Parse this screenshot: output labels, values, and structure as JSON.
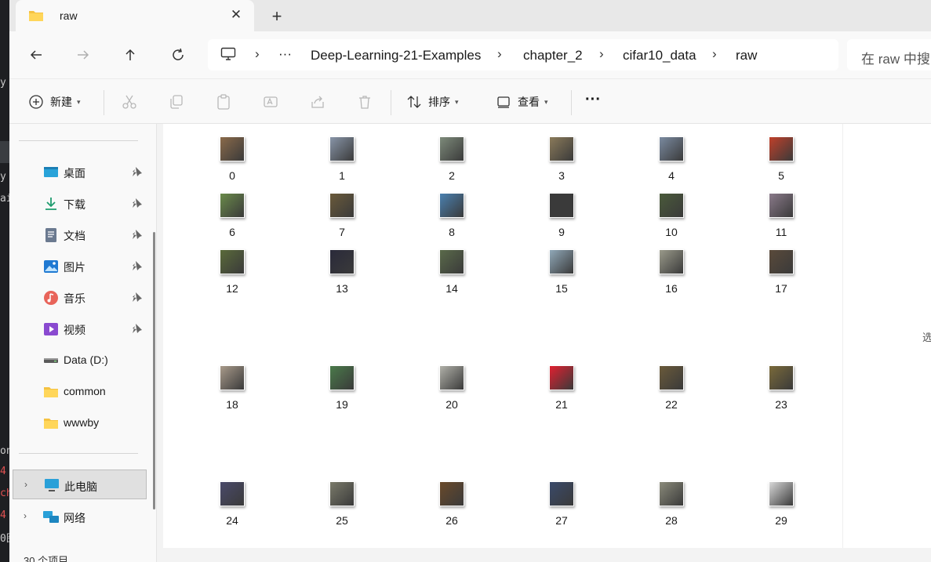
{
  "window": {
    "tab_title": "raw"
  },
  "nav": {
    "ellipsis": "···",
    "breadcrumb": [
      "Deep-Learning-21-Examples",
      "chapter_2",
      "cifar10_data",
      "raw"
    ],
    "search_placeholder": "在 raw 中搜"
  },
  "toolbar": {
    "new_label": "新建",
    "sort_label": "排序",
    "view_label": "查看",
    "more_label": "···"
  },
  "sidebar": {
    "quick": [
      {
        "label": "桌面",
        "icon": "desktop-icon"
      },
      {
        "label": "下载",
        "icon": "download-icon"
      },
      {
        "label": "文档",
        "icon": "document-icon"
      },
      {
        "label": "图片",
        "icon": "pictures-icon"
      },
      {
        "label": "音乐",
        "icon": "music-icon"
      },
      {
        "label": "视频",
        "icon": "video-icon"
      },
      {
        "label": "Data (D:)",
        "icon": "drive-icon"
      },
      {
        "label": "common",
        "icon": "folder-icon"
      },
      {
        "label": "wwwby",
        "icon": "folder-icon"
      }
    ],
    "this_pc": "此电脑",
    "network": "网络"
  },
  "status": {
    "item_count": "30 个项目"
  },
  "side_fragment": "选",
  "files": [
    {
      "name": "0",
      "color": "#8a6a4a"
    },
    {
      "name": "1",
      "color": "#8895a8"
    },
    {
      "name": "2",
      "color": "#7d8a7a"
    },
    {
      "name": "3",
      "color": "#8a7a5a"
    },
    {
      "name": "4",
      "color": "#7a8aa0"
    },
    {
      "name": "5",
      "color": "#c0402a"
    },
    {
      "name": "6",
      "color": "#6a8a4a"
    },
    {
      "name": "7",
      "color": "#6a5a3a"
    },
    {
      "name": "8",
      "color": "#4a80b0"
    },
    {
      "name": "9",
      "color": "#3a3a3a"
    },
    {
      "name": "10",
      "color": "#4a5a3a"
    },
    {
      "name": "11",
      "color": "#8a7a8a"
    },
    {
      "name": "12",
      "color": "#5a6a3a"
    },
    {
      "name": "13",
      "color": "#2a2a3a"
    },
    {
      "name": "14",
      "color": "#5a6a4a"
    },
    {
      "name": "15",
      "color": "#90a8b8"
    },
    {
      "name": "16",
      "color": "#9a9a8a"
    },
    {
      "name": "17",
      "color": "#5a4a3a"
    },
    {
      "name": "18",
      "color": "#a89a8a"
    },
    {
      "name": "19",
      "color": "#4a7a4a"
    },
    {
      "name": "20",
      "color": "#b0b0a8"
    },
    {
      "name": "21",
      "color": "#e02030"
    },
    {
      "name": "22",
      "color": "#6a5a3a"
    },
    {
      "name": "23",
      "color": "#7a6a3a"
    },
    {
      "name": "24",
      "color": "#4a4a6a"
    },
    {
      "name": "25",
      "color": "#7a7a6a"
    },
    {
      "name": "26",
      "color": "#6a4a2a"
    },
    {
      "name": "27",
      "color": "#3a4a6a"
    },
    {
      "name": "28",
      "color": "#8a8a7a"
    },
    {
      "name": "29",
      "color": "#d8d8d8"
    }
  ]
}
